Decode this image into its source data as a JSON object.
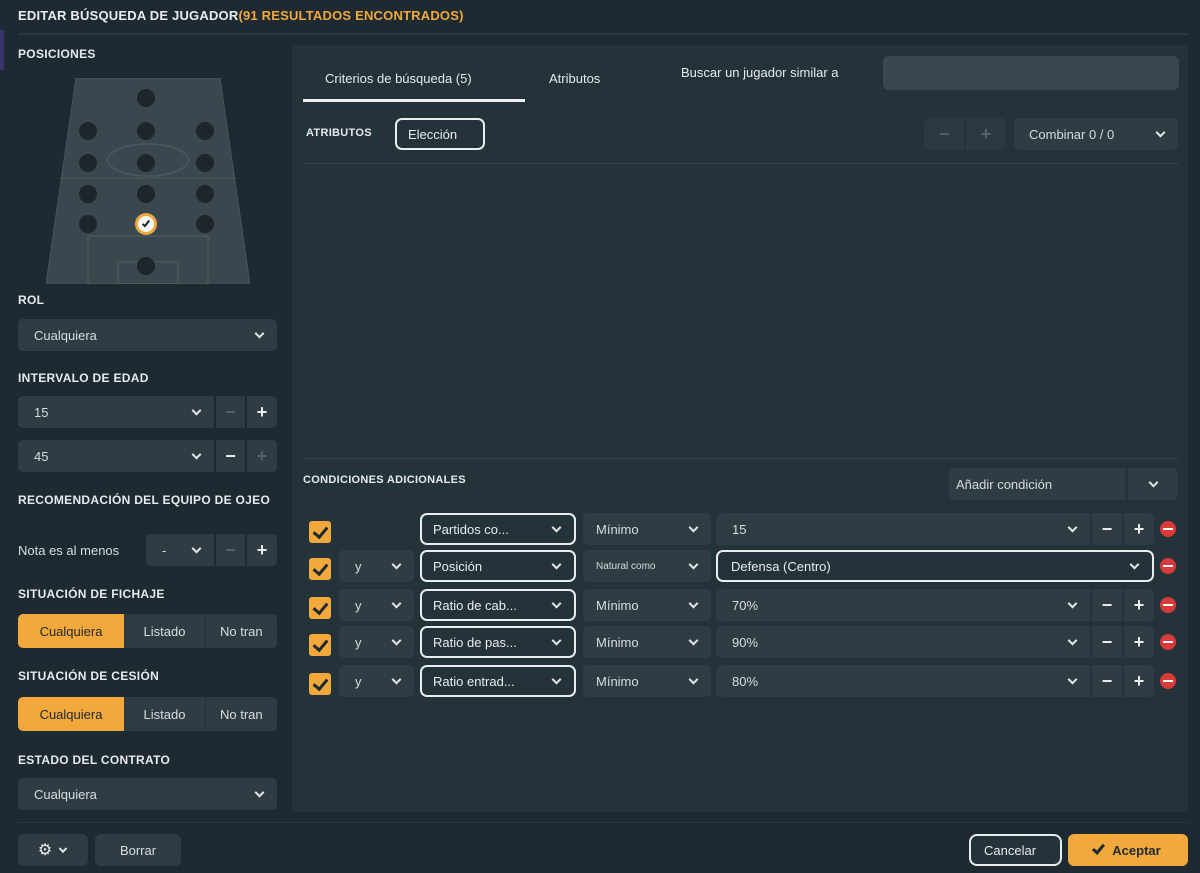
{
  "header": {
    "title": "EDITAR BÚSQUEDA DE JUGADOR",
    "results": "(91 RESULTADOS ENCONTRADOS)"
  },
  "left": {
    "positions_label": "POSICIONES",
    "rol_label": "ROL",
    "rol_value": "Cualquiera",
    "age_label": "INTERVALO DE EDAD",
    "age_min": "15",
    "age_max": "45",
    "scout_label": "RECOMENDACIÓN DEL EQUIPO DE OJEO",
    "scout_note_label": "Nota es al menos",
    "scout_note_value": "-",
    "fichaje_label": "SITUACIÓN DE FICHAJE",
    "fichaje_options": [
      "Cualquiera",
      "Listado",
      "No tran"
    ],
    "cesion_label": "SITUACIÓN DE CESIÓN",
    "cesion_options": [
      "Cualquiera",
      "Listado",
      "No tran"
    ],
    "contrato_label": "ESTADO DEL CONTRATO",
    "contrato_value": "Cualquiera"
  },
  "main": {
    "tabs": [
      "Criterios de búsqueda (5)",
      "Atributos"
    ],
    "similar_label": "Buscar un jugador similar a",
    "similar_placeholder": "",
    "atributos_label": "ATRIBUTOS",
    "eleccion_label": "Elección",
    "combinar_label": "Combinar 0 / 0",
    "conditions_label": "CONDICIONES ADICIONALES",
    "add_condition_label": "Añadir condición",
    "conditions": [
      {
        "connector": "",
        "field": "Partidos co...",
        "op": "Mínimo",
        "value": "15",
        "stepper": true
      },
      {
        "connector": "y",
        "field": "Posición",
        "op": "Natural como",
        "value": "Defensa (Centro)",
        "stepper": false
      },
      {
        "connector": "y",
        "field": "Ratio de cab...",
        "op": "Mínimo",
        "value": "70%",
        "stepper": true
      },
      {
        "connector": "y",
        "field": "Ratio de pas...",
        "op": "Mínimo",
        "value": "90%",
        "stepper": true
      },
      {
        "connector": "y",
        "field": "Ratio entrad...",
        "op": "Mínimo",
        "value": "80%",
        "stepper": true
      }
    ]
  },
  "footer": {
    "borrar": "Borrar",
    "cancelar": "Cancelar",
    "aceptar": "Aceptar"
  },
  "colors": {
    "accent": "#f2a83b",
    "danger": "#d83a3a",
    "bg": "#1e2a31",
    "panel": "#24323a"
  }
}
